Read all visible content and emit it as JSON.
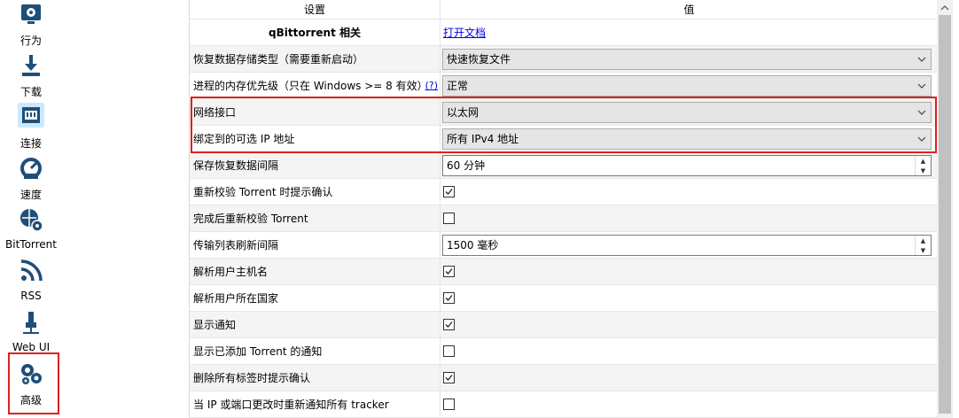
{
  "sidebar": {
    "items": [
      {
        "label": "行为",
        "icon": "settings-icon"
      },
      {
        "label": "下载",
        "icon": "download-icon"
      },
      {
        "label": "连接",
        "icon": "network-icon"
      },
      {
        "label": "速度",
        "icon": "speedometer-icon"
      },
      {
        "label": "BitTorrent",
        "icon": "globe-gear-icon"
      },
      {
        "label": "RSS",
        "icon": "rss-icon"
      },
      {
        "label": "Web UI",
        "icon": "plug-icon"
      },
      {
        "label": "高级",
        "icon": "gears-icon"
      }
    ]
  },
  "table": {
    "header_setting": "设置",
    "header_value": "值",
    "section_title": "qBittorrent 相关",
    "open_docs_link": "打开文档",
    "rows": [
      {
        "label": "恢复数据存储类型（需要重新启动）",
        "type": "combo",
        "value": "快速恢复文件"
      },
      {
        "label": "进程的内存优先级（只在 Windows >= 8 有效）",
        "type": "combo",
        "value": "正常",
        "help": "(?)"
      },
      {
        "label": "网络接口",
        "type": "combo",
        "value": "以太网"
      },
      {
        "label": "绑定到的可选 IP 地址",
        "type": "combo",
        "value": "所有 IPv4 地址"
      },
      {
        "label": "保存恢复数据间隔",
        "type": "spin",
        "value": "60 分钟"
      },
      {
        "label": "重新校验 Torrent 时提示确认",
        "type": "check",
        "checked": true
      },
      {
        "label": "完成后重新校验 Torrent",
        "type": "check",
        "checked": false
      },
      {
        "label": "传输列表刷新间隔",
        "type": "spin",
        "value": "1500 毫秒"
      },
      {
        "label": "解析用户主机名",
        "type": "check",
        "checked": true
      },
      {
        "label": "解析用户所在国家",
        "type": "check",
        "checked": true
      },
      {
        "label": "显示通知",
        "type": "check",
        "checked": true
      },
      {
        "label": "显示已添加 Torrent 的通知",
        "type": "check",
        "checked": false
      },
      {
        "label": "删除所有标签时提示确认",
        "type": "check",
        "checked": true
      },
      {
        "label": "当 IP 或端口更改时重新通知所有 tracker",
        "type": "check",
        "checked": false
      }
    ]
  },
  "colors": {
    "highlight": "#e02020",
    "link": "#0000ee",
    "selected_bg": "#cce8ff",
    "icon": "#1f4e79"
  }
}
